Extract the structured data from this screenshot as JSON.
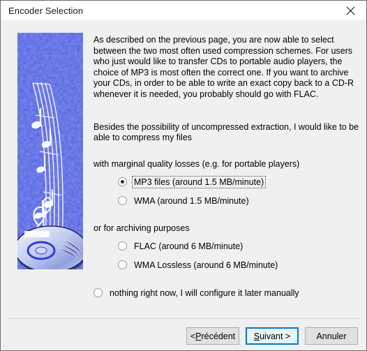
{
  "window": {
    "title": "Encoder Selection",
    "close_icon": "close-icon"
  },
  "body": {
    "paragraph_intro": "As described on the previous page, you are now able to select between the two most often used compression schemes. For users who just would like to transfer CDs to portable audio players, the choice of MP3 is most often the correct one. If you want to archive your CDs, in order to be able to write an exact copy back to a CD-R whenever it is needed, you probably should go with FLAC.",
    "paragraph_besides": "Besides the possibility of uncompressed extraction, I would like to be able to compress my files",
    "group_lossy_label": "with marginal quality losses (e.g. for portable players)",
    "group_archive_label": "or for archiving purposes",
    "options": [
      {
        "id": "mp3",
        "label": "MP3 files (around 1.5 MB/minute)",
        "checked": true,
        "focused": true
      },
      {
        "id": "wma",
        "label": "WMA (around 1.5 MB/minute)",
        "checked": false,
        "focused": false
      },
      {
        "id": "flac",
        "label": "FLAC (around 6 MB/minute)",
        "checked": false,
        "focused": false
      },
      {
        "id": "wma-lossless",
        "label": "WMA Lossless (around 6 MB/minute)",
        "checked": false,
        "focused": false
      },
      {
        "id": "nothing",
        "label": "nothing right now, I will configure it later manually",
        "checked": false,
        "focused": false
      }
    ]
  },
  "footer": {
    "back_prefix": "< ",
    "back_mnemonic": "P",
    "back_rest": "récédent",
    "next_mnemonic": "S",
    "next_rest": "uivant >",
    "cancel_label": "Annuler"
  },
  "artwork": {
    "name": "cd-and-music-notes-artwork",
    "background_color": "#2f34b4",
    "accent_color": "#ffffff"
  },
  "colors": {
    "dialog_background": "#f0f0f0",
    "titlebar_background": "#ffffff",
    "default_button_border": "#0078d7",
    "text": "#000000"
  }
}
